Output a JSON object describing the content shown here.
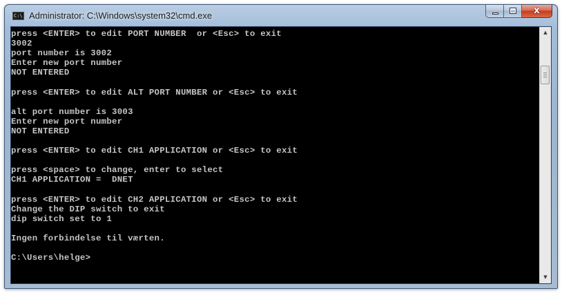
{
  "window": {
    "title": "Administrator: C:\\Windows\\system32\\cmd.exe",
    "icon": "cmd-icon",
    "icon_text": "C:\\",
    "close_glyph": "x",
    "colors": {
      "console_bg": "#000000",
      "console_text": "#c4c4c4",
      "close_button": "#c7432a",
      "frame": "#a2bcd9"
    }
  },
  "console": {
    "lines": [
      "press <ENTER> to edit PORT NUMBER  or <Esc> to exit",
      "3002",
      "port number is 3002",
      "Enter new port number",
      "NOT ENTERED",
      "",
      "press <ENTER> to edit ALT PORT NUMBER or <Esc> to exit",
      "",
      "alt port number is 3003",
      "Enter new port number",
      "NOT ENTERED",
      "",
      "press <ENTER> to edit CH1 APPLICATION or <Esc> to exit",
      "",
      "press <space> to change, enter to select",
      "CH1 APPLICATION =  DNET",
      "",
      "press <ENTER> to edit CH2 APPLICATION or <Esc> to exit",
      "Change the DIP switch to exit",
      "dip switch set to 1",
      "",
      "Ingen forbindelse til værten.",
      "",
      "C:\\Users\\helge>"
    ]
  },
  "scrollbar": {
    "up_arrow": "▲",
    "down_arrow": "▼",
    "position": 0.45
  }
}
